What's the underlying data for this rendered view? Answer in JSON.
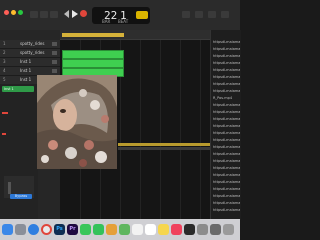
{
  "transport": {
    "bar": "22",
    "beat": "1",
    "bar_label": "BAR",
    "beat_label": "BEAT"
  },
  "tracks": [
    {
      "num": "1",
      "name": "spotty_rides"
    },
    {
      "num": "2",
      "name": "spotty_rides"
    },
    {
      "num": "3",
      "name": "Inst 1"
    },
    {
      "num": "4",
      "name": "Inst 1"
    },
    {
      "num": "5",
      "name": "Inst 1"
    },
    {
      "num": "6",
      "name": ""
    }
  ],
  "inspector": {
    "region_tag": "Inst 1",
    "button": "Bypass"
  },
  "browser": {
    "items": [
      "httpsdLmaiamagra",
      "httpsdLmaiamagra",
      "httpsdLmaiamagra",
      "httpsdLmaiamagra",
      "httpsdLmaiamagra",
      "httpsdLmaiamagra",
      "httpsdLmaiamagra",
      "httpsdLmaiamagra",
      "R_Pos.mp4",
      "httpsdLmaiamagra",
      "httpsdLmaiamagra",
      "httpsdLmaiamagra",
      "httpsdLmaiamagra",
      "httpsdLmaiamagra",
      "httpsdLmaiamagra",
      "httpsdLmaiamagra",
      "httpsdLmaiamagra",
      "httpsdLmaiamagra",
      "httpsdLmaiamagra",
      "httpsdLmaiamagra",
      "httpsdLmaiamagra",
      "httpsdLmaiamagra",
      "httpsdLmaiamagra",
      "httpsdLmaiamagra",
      "httpsdLmaiamagra"
    ]
  },
  "dock": [
    "finder",
    "launchpad",
    "safari",
    "chrome",
    "photoshop",
    "premiere",
    "messages",
    "facetime",
    "logic",
    "maps",
    "photos",
    "calendar",
    "notes",
    "music",
    "terminal",
    "settings",
    "screenshot",
    "archive",
    "trash"
  ],
  "colors": {
    "accent": "#d9b400",
    "region": "#3fcf50",
    "record": "#e0463b",
    "play": "#e7e7e7"
  }
}
